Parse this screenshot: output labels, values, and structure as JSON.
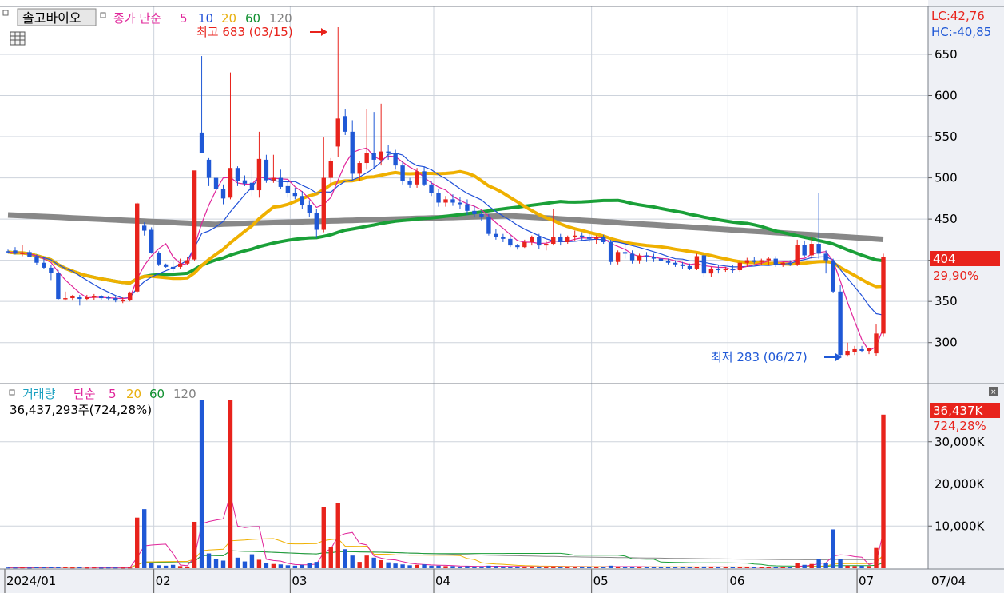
{
  "stock_name": "솔고바이오",
  "price_legend": {
    "prefix": "종가 단순",
    "periods": [
      {
        "label": "5",
        "color": "#e0249a"
      },
      {
        "label": "10",
        "color": "#2050d8"
      },
      {
        "label": "20",
        "color": "#e8b010"
      },
      {
        "label": "60",
        "color": "#109030"
      },
      {
        "label": "120",
        "color": "#808080"
      }
    ]
  },
  "volume_legend": {
    "prefix": "거래량",
    "prefix2": "단순",
    "periods": [
      {
        "label": "5",
        "color": "#e0249a"
      },
      {
        "label": "20",
        "color": "#e8b010"
      },
      {
        "label": "60",
        "color": "#109030"
      },
      {
        "label": "120",
        "color": "#808080"
      }
    ],
    "last_value": "36,437,293주(724,28%)"
  },
  "high_marker": "최고 683 (03/15)",
  "low_marker": "최저 283 (06/27)",
  "lc_label": "LC:42,76",
  "hc_label": "HC:-40,85",
  "current_price_tag": "404",
  "current_change_tag": "29,90%",
  "volume_tag": "36,437K",
  "volume_change_tag": "724,28%",
  "axis_end_label": "07/04",
  "colors": {
    "up": "#e8231c",
    "down": "#1f58d6",
    "grid": "#cdd3dc",
    "axis_bg": "#eef0f5"
  },
  "chart_data": {
    "type": "candlestick",
    "date_range": [
      "2024/01",
      "07/04"
    ],
    "x_labels": [
      "2024/01",
      "02",
      "03",
      "04",
      "05",
      "06",
      "07"
    ],
    "price_axis": {
      "ticks": [
        300,
        350,
        400,
        450,
        500,
        550,
        600,
        650
      ],
      "ylim": [
        258,
        682
      ]
    },
    "volume_axis": {
      "ticks": [
        "10,000K",
        "20,000K",
        "30,000K"
      ],
      "ylim": [
        0,
        40000
      ]
    },
    "ohlc": [
      [
        411,
        413,
        409,
        410
      ],
      [
        412,
        416,
        407,
        408
      ],
      [
        408,
        419,
        405,
        409
      ],
      [
        410,
        412,
        404,
        404
      ],
      [
        405,
        407,
        394,
        397
      ],
      [
        397,
        404,
        389,
        391
      ],
      [
        391,
        394,
        376,
        385
      ],
      [
        385,
        388,
        352,
        353
      ],
      [
        353,
        362,
        351,
        354
      ],
      [
        354,
        358,
        351,
        357
      ],
      [
        355,
        358,
        345,
        353
      ],
      [
        353,
        358,
        351,
        355
      ],
      [
        355,
        359,
        352,
        356
      ],
      [
        356,
        358,
        352,
        354
      ],
      [
        355,
        357,
        351,
        354
      ],
      [
        354,
        357,
        349,
        351
      ],
      [
        350,
        355,
        348,
        352
      ],
      [
        352,
        362,
        350,
        361
      ],
      [
        362,
        470,
        360,
        469
      ],
      [
        442,
        446,
        430,
        436
      ],
      [
        437,
        440,
        408,
        409
      ],
      [
        409,
        411,
        393,
        395
      ],
      [
        395,
        396,
        391,
        392
      ],
      [
        392,
        400,
        386,
        389
      ],
      [
        392,
        402,
        389,
        396
      ],
      [
        396,
        404,
        394,
        400
      ],
      [
        401,
        506,
        399,
        509
      ],
      [
        555,
        648,
        530,
        530
      ],
      [
        522,
        524,
        490,
        500
      ],
      [
        500,
        502,
        480,
        486
      ],
      [
        486,
        492,
        468,
        475
      ],
      [
        476,
        628,
        474,
        512
      ],
      [
        512,
        514,
        490,
        496
      ],
      [
        497,
        503,
        490,
        493
      ],
      [
        494,
        510,
        478,
        485
      ],
      [
        485,
        556,
        476,
        523
      ],
      [
        522,
        528,
        494,
        497
      ],
      [
        497,
        528,
        494,
        500
      ],
      [
        500,
        510,
        486,
        489
      ],
      [
        490,
        496,
        476,
        482
      ],
      [
        482,
        488,
        474,
        478
      ],
      [
        478,
        484,
        462,
        467
      ],
      [
        467,
        473,
        452,
        457
      ],
      [
        457,
        462,
        427,
        437
      ],
      [
        437,
        549,
        434,
        500
      ],
      [
        500,
        524,
        492,
        520
      ],
      [
        538,
        683,
        525,
        572
      ],
      [
        575,
        583,
        552,
        556
      ],
      [
        556,
        570,
        498,
        505
      ],
      [
        505,
        520,
        496,
        518
      ],
      [
        518,
        584,
        510,
        530
      ],
      [
        530,
        580,
        512,
        522
      ],
      [
        522,
        590,
        515,
        532
      ],
      [
        532,
        540,
        522,
        530
      ],
      [
        530,
        534,
        510,
        515
      ],
      [
        515,
        520,
        492,
        496
      ],
      [
        496,
        500,
        488,
        492
      ],
      [
        492,
        512,
        488,
        508
      ],
      [
        508,
        514,
        490,
        492
      ],
      [
        492,
        496,
        478,
        482
      ],
      [
        482,
        486,
        465,
        470
      ],
      [
        470,
        478,
        465,
        474
      ],
      [
        474,
        480,
        466,
        470
      ],
      [
        470,
        477,
        462,
        468
      ],
      [
        468,
        474,
        455,
        460
      ],
      [
        460,
        466,
        452,
        456
      ],
      [
        456,
        460,
        448,
        452
      ],
      [
        452,
        456,
        430,
        432
      ],
      [
        432,
        438,
        425,
        428
      ],
      [
        428,
        432,
        422,
        426
      ],
      [
        426,
        430,
        416,
        418
      ],
      [
        418,
        420,
        413,
        416
      ],
      [
        416,
        425,
        415,
        422
      ],
      [
        422,
        430,
        418,
        428
      ],
      [
        428,
        432,
        414,
        418
      ],
      [
        418,
        424,
        412,
        420
      ],
      [
        420,
        462,
        418,
        428
      ],
      [
        428,
        432,
        418,
        422
      ],
      [
        422,
        430,
        420,
        428
      ],
      [
        428,
        436,
        424,
        430
      ],
      [
        430,
        434,
        424,
        428
      ],
      [
        428,
        432,
        422,
        426
      ],
      [
        426,
        430,
        420,
        428
      ],
      [
        428,
        431,
        420,
        422
      ],
      [
        422,
        425,
        395,
        398
      ],
      [
        398,
        412,
        395,
        410
      ],
      [
        410,
        418,
        402,
        408
      ],
      [
        408,
        412,
        396,
        400
      ],
      [
        400,
        408,
        396,
        406
      ],
      [
        406,
        410,
        398,
        404
      ],
      [
        404,
        408,
        398,
        402
      ],
      [
        402,
        405,
        397,
        399
      ],
      [
        399,
        402,
        395,
        397
      ],
      [
        397,
        400,
        392,
        395
      ],
      [
        395,
        398,
        390,
        393
      ],
      [
        393,
        396,
        388,
        390
      ],
      [
        390,
        408,
        388,
        405
      ],
      [
        406,
        408,
        380,
        384
      ],
      [
        384,
        392,
        380,
        390
      ],
      [
        390,
        394,
        384,
        388
      ],
      [
        388,
        392,
        386,
        390
      ],
      [
        390,
        394,
        385,
        388
      ],
      [
        388,
        400,
        386,
        397
      ],
      [
        397,
        403,
        392,
        400
      ],
      [
        400,
        404,
        396,
        398
      ],
      [
        398,
        402,
        394,
        400
      ],
      [
        400,
        404,
        394,
        402
      ],
      [
        402,
        405,
        392,
        395
      ],
      [
        395,
        398,
        392,
        397
      ],
      [
        397,
        400,
        393,
        395
      ],
      [
        395,
        425,
        393,
        419
      ],
      [
        419,
        424,
        404,
        406
      ],
      [
        406,
        428,
        402,
        420
      ],
      [
        420,
        482,
        402,
        408
      ],
      [
        408,
        412,
        384,
        400
      ],
      [
        400,
        402,
        360,
        362
      ],
      [
        362,
        370,
        282,
        285
      ],
      [
        285,
        300,
        283,
        290
      ],
      [
        289,
        296,
        285,
        292
      ],
      [
        292,
        296,
        288,
        290
      ],
      [
        290,
        294,
        286,
        293
      ],
      [
        287,
        322,
        284,
        311
      ],
      [
        311,
        408,
        307,
        404
      ]
    ],
    "volume": [
      150,
      140,
      160,
      130,
      200,
      180,
      220,
      350,
      200,
      150,
      180,
      140,
      160,
      120,
      150,
      140,
      130,
      150,
      12000,
      14000,
      1200,
      700,
      600,
      800,
      500,
      400,
      11000,
      40000,
      3500,
      2200,
      1800,
      40000,
      2500,
      1600,
      3300,
      2000,
      1200,
      1000,
      900,
      700,
      600,
      800,
      1200,
      1500,
      14500,
      5000,
      15500,
      4500,
      3000,
      1500,
      3000,
      2500,
      1900,
      1400,
      1100,
      900,
      700,
      800,
      900,
      600,
      600,
      500,
      500,
      400,
      500,
      400,
      400,
      600,
      500,
      400,
      300,
      300,
      400,
      400,
      300,
      300,
      400,
      350,
      300,
      300,
      300,
      300,
      300,
      300,
      600,
      400,
      300,
      300,
      300,
      300,
      300,
      250,
      250,
      250,
      250,
      250,
      300,
      400,
      300,
      250,
      250,
      250,
      250,
      250,
      250,
      250,
      250,
      250,
      250,
      250,
      1200,
      800,
      1000,
      2200,
      1200,
      9200,
      2200,
      600,
      500,
      600,
      500,
      4800,
      36437
    ]
  }
}
